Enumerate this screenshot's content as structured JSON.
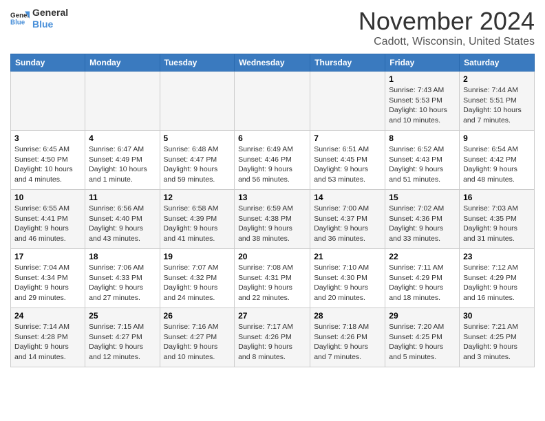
{
  "header": {
    "title": "November 2024",
    "location": "Cadott, Wisconsin, United States"
  },
  "logo": {
    "line1": "General",
    "line2": "Blue"
  },
  "days_of_week": [
    "Sunday",
    "Monday",
    "Tuesday",
    "Wednesday",
    "Thursday",
    "Friday",
    "Saturday"
  ],
  "weeks": [
    [
      {
        "day": "",
        "info": ""
      },
      {
        "day": "",
        "info": ""
      },
      {
        "day": "",
        "info": ""
      },
      {
        "day": "",
        "info": ""
      },
      {
        "day": "",
        "info": ""
      },
      {
        "day": "1",
        "info": "Sunrise: 7:43 AM\nSunset: 5:53 PM\nDaylight: 10 hours and 10 minutes."
      },
      {
        "day": "2",
        "info": "Sunrise: 7:44 AM\nSunset: 5:51 PM\nDaylight: 10 hours and 7 minutes."
      }
    ],
    [
      {
        "day": "3",
        "info": "Sunrise: 6:45 AM\nSunset: 4:50 PM\nDaylight: 10 hours and 4 minutes."
      },
      {
        "day": "4",
        "info": "Sunrise: 6:47 AM\nSunset: 4:49 PM\nDaylight: 10 hours and 1 minute."
      },
      {
        "day": "5",
        "info": "Sunrise: 6:48 AM\nSunset: 4:47 PM\nDaylight: 9 hours and 59 minutes."
      },
      {
        "day": "6",
        "info": "Sunrise: 6:49 AM\nSunset: 4:46 PM\nDaylight: 9 hours and 56 minutes."
      },
      {
        "day": "7",
        "info": "Sunrise: 6:51 AM\nSunset: 4:45 PM\nDaylight: 9 hours and 53 minutes."
      },
      {
        "day": "8",
        "info": "Sunrise: 6:52 AM\nSunset: 4:43 PM\nDaylight: 9 hours and 51 minutes."
      },
      {
        "day": "9",
        "info": "Sunrise: 6:54 AM\nSunset: 4:42 PM\nDaylight: 9 hours and 48 minutes."
      }
    ],
    [
      {
        "day": "10",
        "info": "Sunrise: 6:55 AM\nSunset: 4:41 PM\nDaylight: 9 hours and 46 minutes."
      },
      {
        "day": "11",
        "info": "Sunrise: 6:56 AM\nSunset: 4:40 PM\nDaylight: 9 hours and 43 minutes."
      },
      {
        "day": "12",
        "info": "Sunrise: 6:58 AM\nSunset: 4:39 PM\nDaylight: 9 hours and 41 minutes."
      },
      {
        "day": "13",
        "info": "Sunrise: 6:59 AM\nSunset: 4:38 PM\nDaylight: 9 hours and 38 minutes."
      },
      {
        "day": "14",
        "info": "Sunrise: 7:00 AM\nSunset: 4:37 PM\nDaylight: 9 hours and 36 minutes."
      },
      {
        "day": "15",
        "info": "Sunrise: 7:02 AM\nSunset: 4:36 PM\nDaylight: 9 hours and 33 minutes."
      },
      {
        "day": "16",
        "info": "Sunrise: 7:03 AM\nSunset: 4:35 PM\nDaylight: 9 hours and 31 minutes."
      }
    ],
    [
      {
        "day": "17",
        "info": "Sunrise: 7:04 AM\nSunset: 4:34 PM\nDaylight: 9 hours and 29 minutes."
      },
      {
        "day": "18",
        "info": "Sunrise: 7:06 AM\nSunset: 4:33 PM\nDaylight: 9 hours and 27 minutes."
      },
      {
        "day": "19",
        "info": "Sunrise: 7:07 AM\nSunset: 4:32 PM\nDaylight: 9 hours and 24 minutes."
      },
      {
        "day": "20",
        "info": "Sunrise: 7:08 AM\nSunset: 4:31 PM\nDaylight: 9 hours and 22 minutes."
      },
      {
        "day": "21",
        "info": "Sunrise: 7:10 AM\nSunset: 4:30 PM\nDaylight: 9 hours and 20 minutes."
      },
      {
        "day": "22",
        "info": "Sunrise: 7:11 AM\nSunset: 4:29 PM\nDaylight: 9 hours and 18 minutes."
      },
      {
        "day": "23",
        "info": "Sunrise: 7:12 AM\nSunset: 4:29 PM\nDaylight: 9 hours and 16 minutes."
      }
    ],
    [
      {
        "day": "24",
        "info": "Sunrise: 7:14 AM\nSunset: 4:28 PM\nDaylight: 9 hours and 14 minutes."
      },
      {
        "day": "25",
        "info": "Sunrise: 7:15 AM\nSunset: 4:27 PM\nDaylight: 9 hours and 12 minutes."
      },
      {
        "day": "26",
        "info": "Sunrise: 7:16 AM\nSunset: 4:27 PM\nDaylight: 9 hours and 10 minutes."
      },
      {
        "day": "27",
        "info": "Sunrise: 7:17 AM\nSunset: 4:26 PM\nDaylight: 9 hours and 8 minutes."
      },
      {
        "day": "28",
        "info": "Sunrise: 7:18 AM\nSunset: 4:26 PM\nDaylight: 9 hours and 7 minutes."
      },
      {
        "day": "29",
        "info": "Sunrise: 7:20 AM\nSunset: 4:25 PM\nDaylight: 9 hours and 5 minutes."
      },
      {
        "day": "30",
        "info": "Sunrise: 7:21 AM\nSunset: 4:25 PM\nDaylight: 9 hours and 3 minutes."
      }
    ]
  ]
}
